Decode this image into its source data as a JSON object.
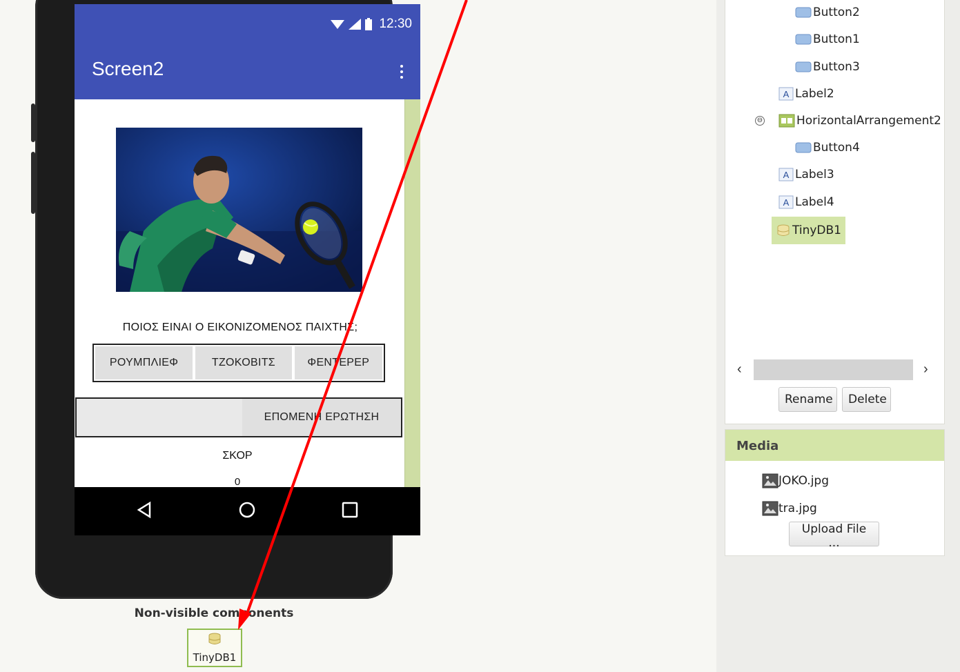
{
  "phone": {
    "status_time": "12:30",
    "app_title": "Screen2",
    "question_label": "ΠΟΙΟΣ ΕΙΝΑΙ Ο ΕΙΚΟΝΙΖΟΜΕΝΟΣ ΠΑΙΧΤΗΣ;",
    "answer_buttons": [
      "ΡΟΥΜΠΛΙΕΦ",
      "ΤΖΟΚΟΒΙΤΣ",
      "ΦΕΝΤΕΡΕΡ"
    ],
    "next_button": "ΕΠΟΜΕΝΗ ΕΡΩΤΗΣΗ",
    "score_label": "ΣΚΟΡ",
    "score_value": "0"
  },
  "non_visible": {
    "title": "Non-visible components",
    "items": [
      "TinyDB1"
    ]
  },
  "components": {
    "tree": [
      {
        "label": "Button2",
        "icon": "button-icon"
      },
      {
        "label": "Button1",
        "icon": "button-icon"
      },
      {
        "label": "Button3",
        "icon": "button-icon"
      },
      {
        "label": "Label2",
        "icon": "label-icon"
      },
      {
        "label": "HorizontalArrangement2",
        "icon": "arrangement-icon"
      },
      {
        "label": "Button4",
        "icon": "button-icon"
      },
      {
        "label": "Label3",
        "icon": "label-icon"
      },
      {
        "label": "Label4",
        "icon": "label-icon"
      },
      {
        "label": "TinyDB1",
        "icon": "database-icon",
        "selected": true
      }
    ],
    "collapse_symbol": "⊖",
    "rename_label": "Rename",
    "delete_label": "Delete"
  },
  "media": {
    "title": "Media",
    "files": [
      "JOKO.jpg",
      "tra.jpg"
    ],
    "upload_label": "Upload File ..."
  },
  "colors": {
    "appbar": "#3f51b5",
    "selection": "#d4e5a8",
    "annotation_arrow": "#ff0000"
  }
}
